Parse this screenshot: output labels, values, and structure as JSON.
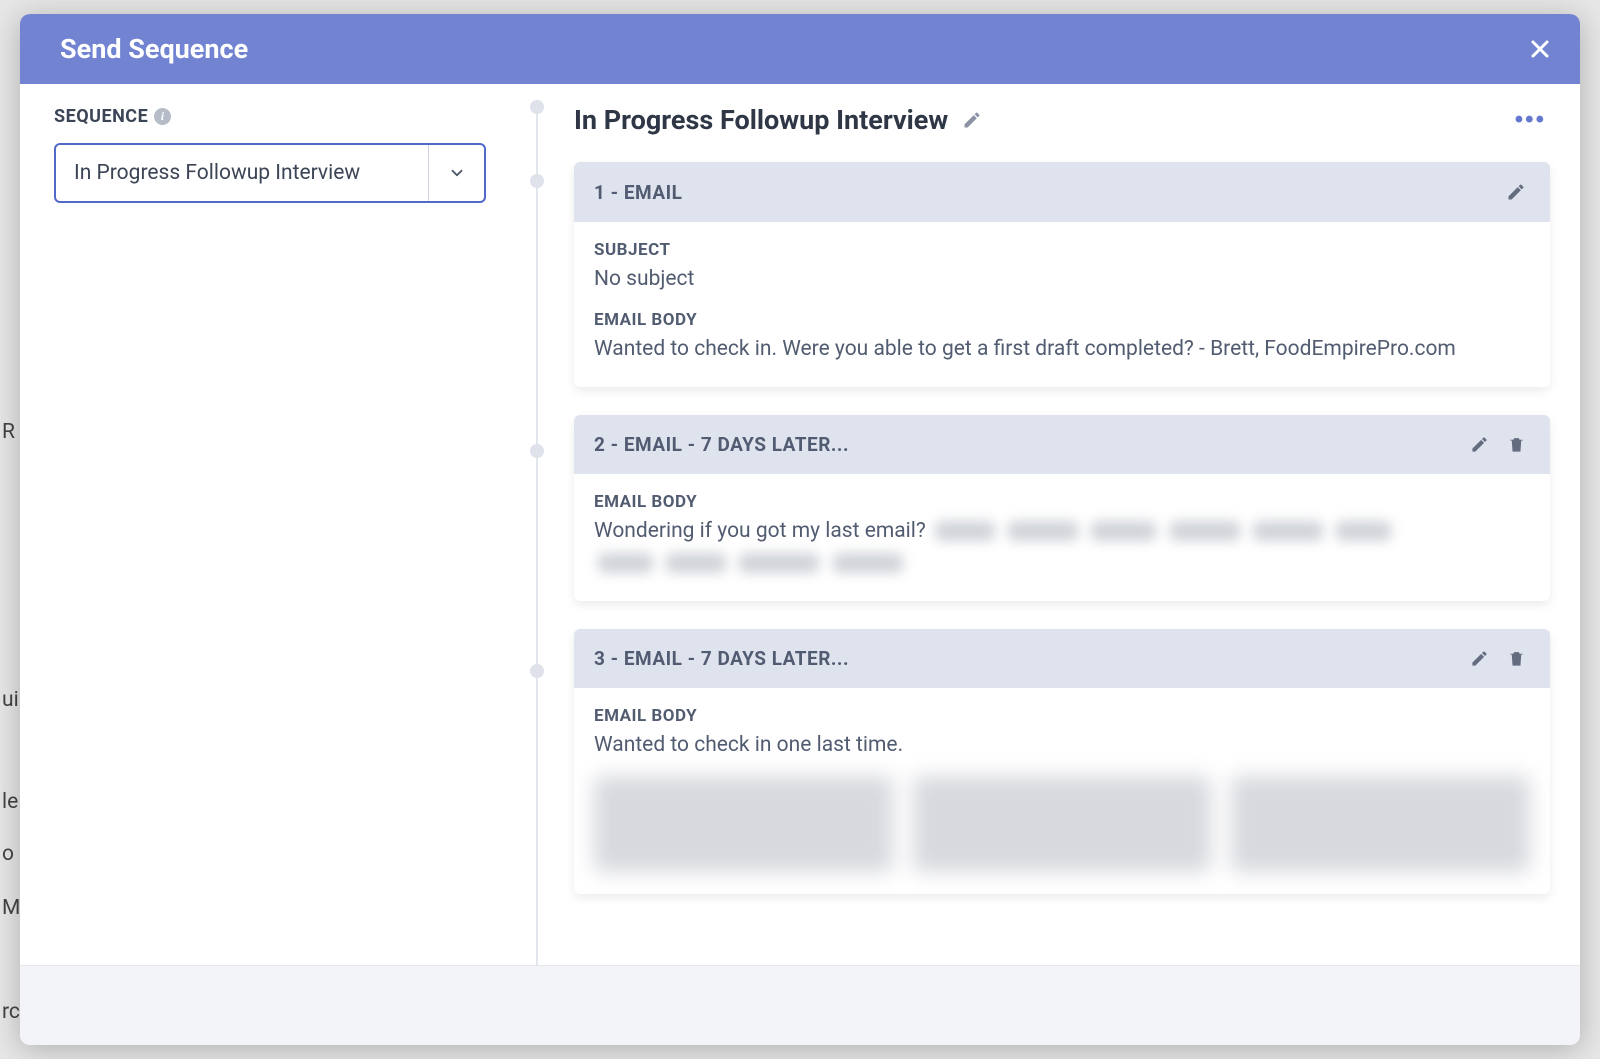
{
  "modal": {
    "title": "Send Sequence"
  },
  "sidebar": {
    "field_label": "SEQUENCE",
    "selected": "In Progress Followup Interview"
  },
  "sequence": {
    "title": "In Progress Followup Interview",
    "steps": [
      {
        "header": "1 - EMAIL",
        "subject_label": "SUBJECT",
        "subject": "No subject",
        "body_label": "EMAIL BODY",
        "body": "Wanted to check in. Were you able to get a first draft completed? - Brett, FoodEmpirePro.com"
      },
      {
        "header": "2 - EMAIL - 7 DAYS LATER...",
        "body_label": "EMAIL BODY",
        "body_prefix": "Wondering if you got my last email? "
      },
      {
        "header": "3 - EMAIL - 7 DAYS LATER...",
        "body_label": "EMAIL BODY",
        "body": "Wanted to check in one last time."
      }
    ]
  }
}
